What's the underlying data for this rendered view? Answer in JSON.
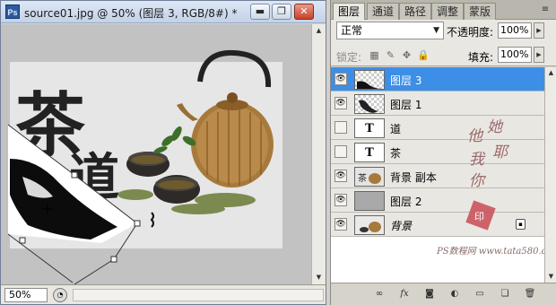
{
  "document": {
    "app_logo": "Ps",
    "title": "source01.jpg @ 50% (图层 3, RGB/8#) *",
    "zoom": "50%",
    "min_glyph": "▬",
    "restore_glyph": "❐",
    "close_glyph": "✕"
  },
  "canvas": {
    "calligraphy_1": "茶",
    "calligraphy_2": "道"
  },
  "layers_panel": {
    "tabs": [
      {
        "label": "图层",
        "active": true
      },
      {
        "label": "通道",
        "active": false
      },
      {
        "label": "路径",
        "active": false
      },
      {
        "label": "调整",
        "active": false
      },
      {
        "label": "蒙版",
        "active": false
      }
    ],
    "blend_mode": "正常",
    "opacity_label": "不透明度:",
    "opacity": "100%",
    "lock_label": "锁定:",
    "fill_label": "填充:",
    "fill": "100%",
    "layers": [
      {
        "name": "图层 3",
        "visible": true,
        "selected": true,
        "thumb": "checker-brush"
      },
      {
        "name": "图层 1",
        "visible": true,
        "selected": false,
        "thumb": "checker-brush"
      },
      {
        "name": "道",
        "visible": false,
        "selected": false,
        "thumb": "text",
        "thumb_glyph": "T"
      },
      {
        "name": "茶",
        "visible": false,
        "selected": false,
        "thumb": "text",
        "thumb_glyph": "T"
      },
      {
        "name": "背景 副本",
        "visible": true,
        "selected": false,
        "thumb": "photo"
      },
      {
        "name": "图层 2",
        "visible": true,
        "selected": false,
        "thumb": "gray"
      },
      {
        "name": "背景",
        "visible": true,
        "selected": false,
        "thumb": "photo",
        "locked": true
      }
    ],
    "watermark_text": "PS数程网 www.tata580.com",
    "watermark_vertical": "他她我耶你"
  },
  "colors": {
    "accent_selected": "#3d8ee6",
    "panel_bg": "#d6d3cb",
    "canvas_bg": "#c2c2c2"
  }
}
